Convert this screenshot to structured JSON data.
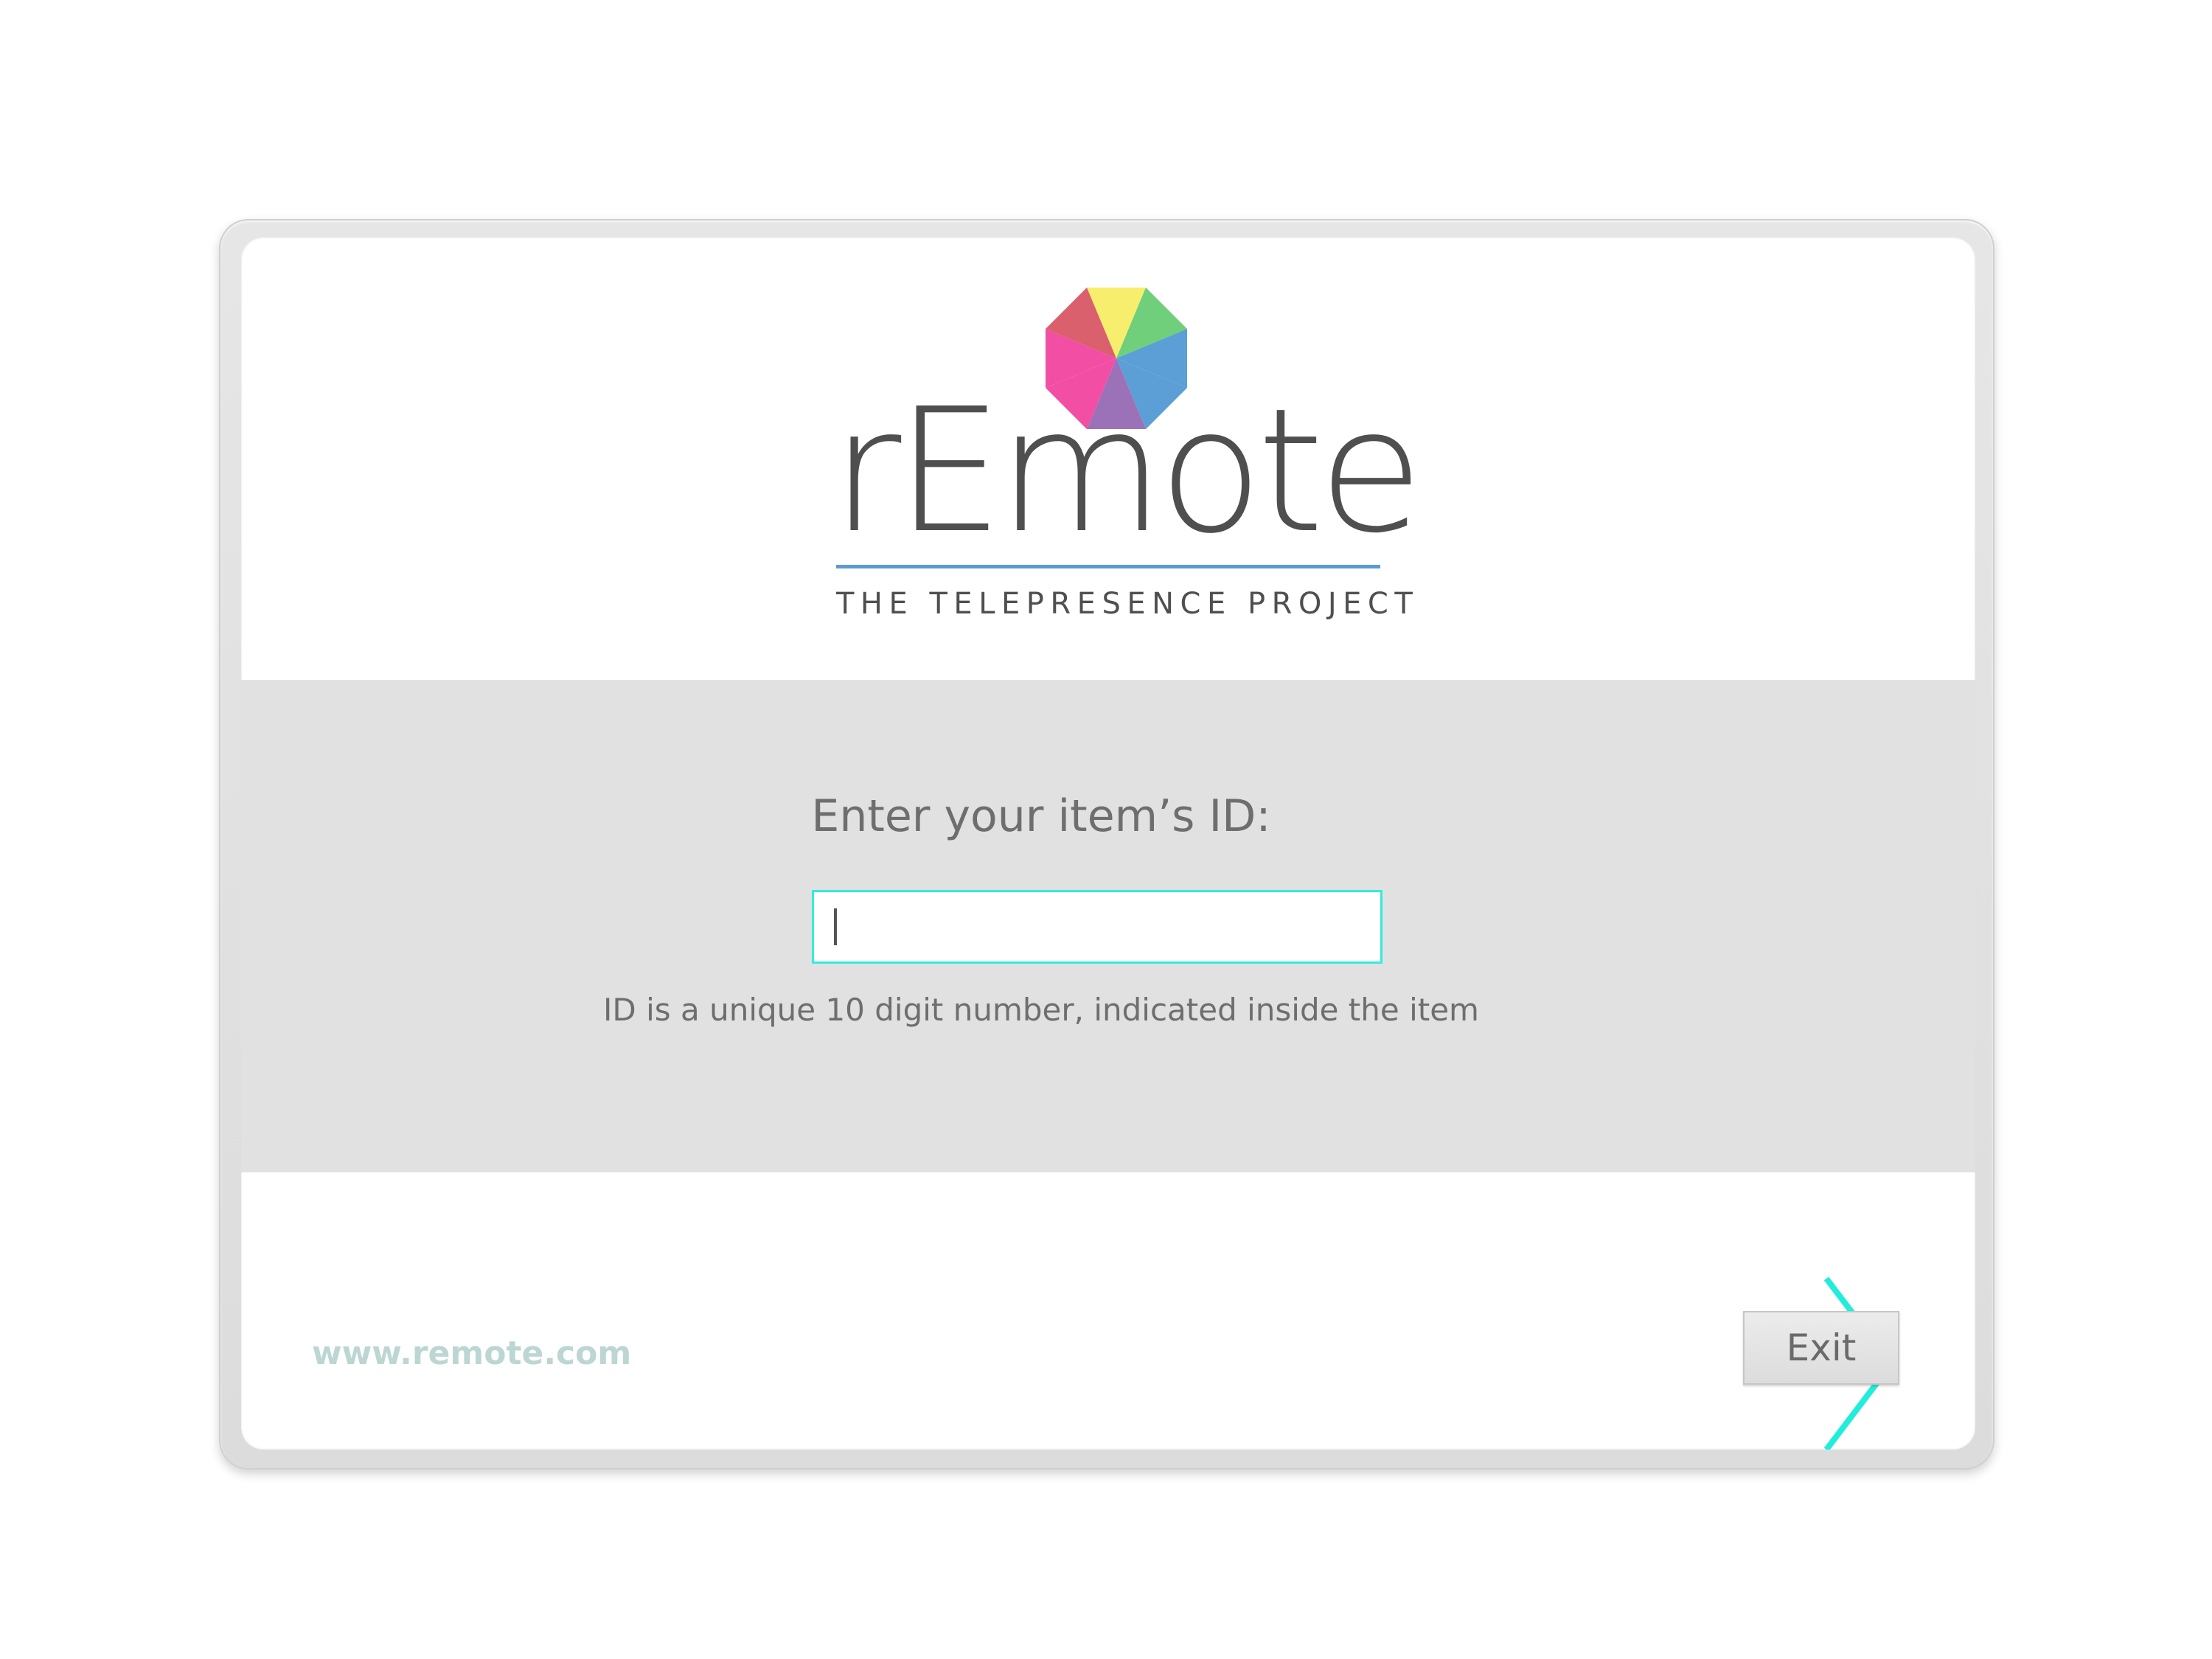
{
  "app": {
    "brand_name": "rEmote",
    "tagline": "THE TELEPRESENCE PROJECT",
    "brand_colors": {
      "text": "#4f4f4f",
      "rule": "#5c9bd1",
      "accent": "#33ecdf",
      "link": "#bcd6d3"
    },
    "logo_icon": "multicolor-octagon-logo",
    "logo_segment_colors": [
      "#f7ee6d",
      "#6fcf7b",
      "#5b9fd6",
      "#9b72b8",
      "#f24ea4",
      "#d9606c"
    ]
  },
  "id_entry": {
    "prompt": "Enter your item’s ID:",
    "input_value": "",
    "input_placeholder": "",
    "hint": "ID is a unique 10 digit number, indicated inside the item",
    "next_icon": "chevron-right-icon"
  },
  "footer": {
    "website": "www.remote.com",
    "exit_label": "Exit"
  }
}
